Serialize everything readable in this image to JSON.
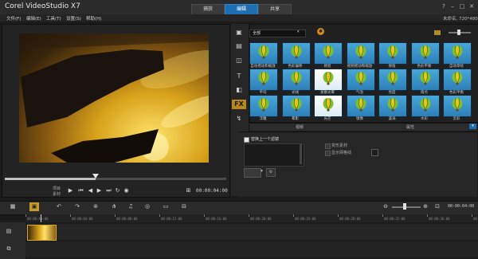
{
  "window": {
    "title": "Corel VideoStudio X7",
    "modes": [
      {
        "label": "捕获",
        "active": false
      },
      {
        "label": "编辑",
        "active": true
      },
      {
        "label": "共享",
        "active": false
      }
    ],
    "buttons": [
      "?",
      "–",
      "□",
      "✕"
    ]
  },
  "menu": {
    "items": [
      "文件(F)",
      "编辑(E)",
      "工具(T)",
      "设置(S)",
      "帮助(H)"
    ],
    "right_text": "未命名, 720*480"
  },
  "player": {
    "project_label": "项目",
    "clip_label": "素材",
    "timecode": "00:00:04:00",
    "controls": [
      "play",
      "home",
      "prev-frame",
      "next-frame",
      "end",
      "repeat",
      "volume",
      "fit"
    ],
    "progress": 0.41
  },
  "library": {
    "category": "全部",
    "colors": {
      "accent": "#1d6fb0",
      "active_tool": "#b7871c",
      "clip_border": "#d4a91f"
    },
    "tools": [
      "media-icon",
      "instant-project-icon",
      "transition-icon",
      "title-icon",
      "graphic-icon",
      "filter-icon",
      "path-icon"
    ],
    "thumbnails": [
      {
        "label": "自动摇动和缩放",
        "style": "blue"
      },
      {
        "label": "色彩偏移",
        "style": "blue"
      },
      {
        "label": "修剪",
        "style": "blue"
      },
      {
        "label": "视频摇动和缩放",
        "style": "blue"
      },
      {
        "label": "保留",
        "style": "blue"
      },
      {
        "label": "色彩平衡",
        "style": "blue"
      },
      {
        "label": "自动草绘",
        "style": "blue"
      },
      {
        "label": "平均",
        "style": "blue"
      },
      {
        "label": "光线",
        "style": "blue"
      },
      {
        "label": "发散光晕",
        "style": "white"
      },
      {
        "label": "气泡",
        "style": "blue"
      },
      {
        "label": "亮度",
        "style": "blue"
      },
      {
        "label": "雨点",
        "style": "blue"
      },
      {
        "label": "色彩平衡",
        "style": "blue"
      },
      {
        "label": "浮雕",
        "style": "blue"
      },
      {
        "label": "晕影",
        "style": "blue"
      },
      {
        "label": "光芒",
        "style": "white"
      },
      {
        "label": "镜像",
        "style": "blue"
      },
      {
        "label": "漩涡",
        "style": "blue"
      },
      {
        "label": "水彩",
        "style": "blue"
      },
      {
        "label": "云彩",
        "style": "blue"
      }
    ],
    "tabs": [
      "视频",
      "属性"
    ]
  },
  "options": {
    "checkbox_label": "替换上一个滤镜",
    "option_a": "变形素材",
    "option_b": "显示网格线"
  },
  "timeline": {
    "timecode": "00:00:04:00",
    "ruler_labels": [
      "00:00:00:00",
      "00:00:04:00",
      "00:00:08:00",
      "00:00:12:00",
      "00:00:16:00",
      "00:00:20:00",
      "00:00:24:00",
      "00:00:28:00",
      "00:00:32:00",
      "00:00:36:00",
      "00:00:40:00"
    ]
  }
}
